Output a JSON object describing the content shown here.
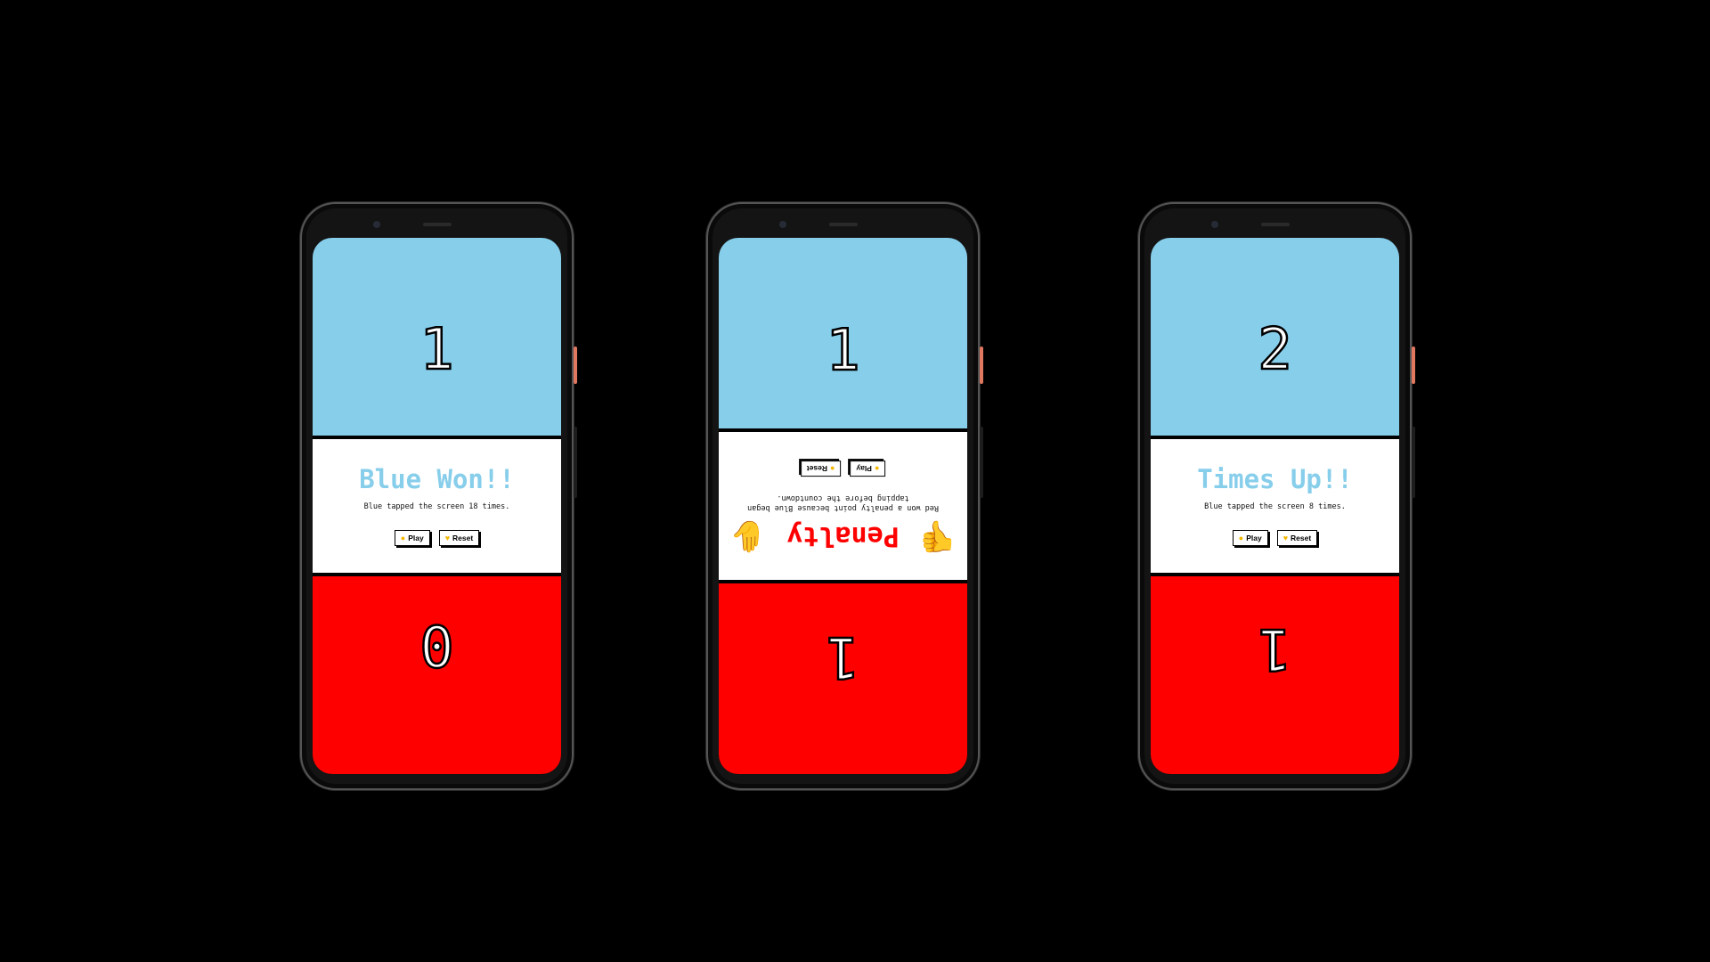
{
  "colors": {
    "blue": "#87ceeb",
    "red": "#ff0000",
    "background": "#000000",
    "panel": "#ffffff"
  },
  "phones": [
    {
      "blue_score": "1",
      "red_score": "0",
      "headline": "Blue Won!!",
      "message": "Blue tapped the screen 18 times.",
      "play_label": "Play",
      "reset_label": "Reset",
      "play_icon": "lemon-icon",
      "reset_icon": "heart-icon"
    },
    {
      "blue_score": "1",
      "red_score": "1",
      "headline": "Penalty",
      "message": "Red won a penalty point because Blue began tapping before the countdown.",
      "play_label": "Play",
      "reset_label": "Reset",
      "play_icon": "lemon-icon",
      "reset_icon": "lemon-icon",
      "left_icon": "thumbs-down-icon",
      "right_icon": "raised-hand-icon"
    },
    {
      "blue_score": "2",
      "red_score": "1",
      "headline": "Times Up!!",
      "message": "Blue tapped the screen 8 times.",
      "play_label": "Play",
      "reset_label": "Reset",
      "play_icon": "lemon-icon",
      "reset_icon": "heart-icon"
    }
  ]
}
